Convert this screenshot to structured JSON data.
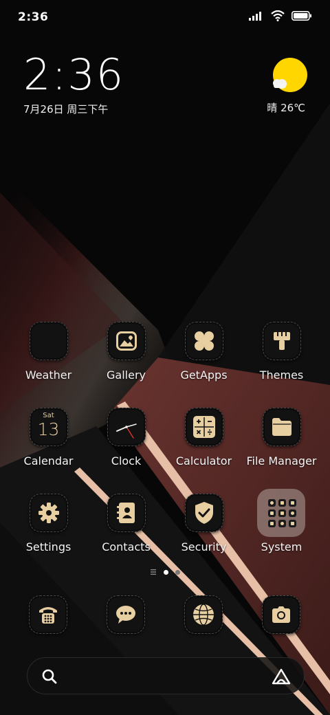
{
  "status_bar": {
    "time": "2:36",
    "icons": [
      "signal-icon",
      "wifi-icon",
      "battery-icon"
    ]
  },
  "clock_widget": {
    "time": "2:36",
    "date": "7月26日 周三下午"
  },
  "weather_widget": {
    "icon": "sun-cloud-icon",
    "summary": "晴 26℃"
  },
  "apps": [
    {
      "label": "Weather",
      "icon": "weather-icon"
    },
    {
      "label": "Gallery",
      "icon": "gallery-icon"
    },
    {
      "label": "GetApps",
      "icon": "getapps-icon"
    },
    {
      "label": "Themes",
      "icon": "themes-brush-icon"
    },
    {
      "label": "Calendar",
      "icon": "calendar-icon",
      "day_name": "Sat",
      "day_num": "13"
    },
    {
      "label": "Clock",
      "icon": "clock-icon"
    },
    {
      "label": "Calculator",
      "icon": "calculator-icon"
    },
    {
      "label": "File Manager",
      "icon": "folder-icon"
    },
    {
      "label": "Settings",
      "icon": "gear-icon"
    },
    {
      "label": "Contacts",
      "icon": "contacts-icon"
    },
    {
      "label": "Security",
      "icon": "shield-check-icon"
    },
    {
      "label": "System",
      "icon": "app-folder-icon"
    }
  ],
  "page_indicator": {
    "pages": 2,
    "current": 1
  },
  "dock": [
    {
      "icon": "phone-icon"
    },
    {
      "icon": "messages-icon"
    },
    {
      "icon": "browser-icon"
    },
    {
      "icon": "camera-icon"
    }
  ],
  "search_bar": {
    "left_icon": "search-icon",
    "right_icon": "assistant-icon"
  },
  "colors": {
    "gold": "#e8cfa2",
    "leather_red": "#5a2a26",
    "stripe": "#e6bfa6",
    "sun": "#ffd600"
  }
}
